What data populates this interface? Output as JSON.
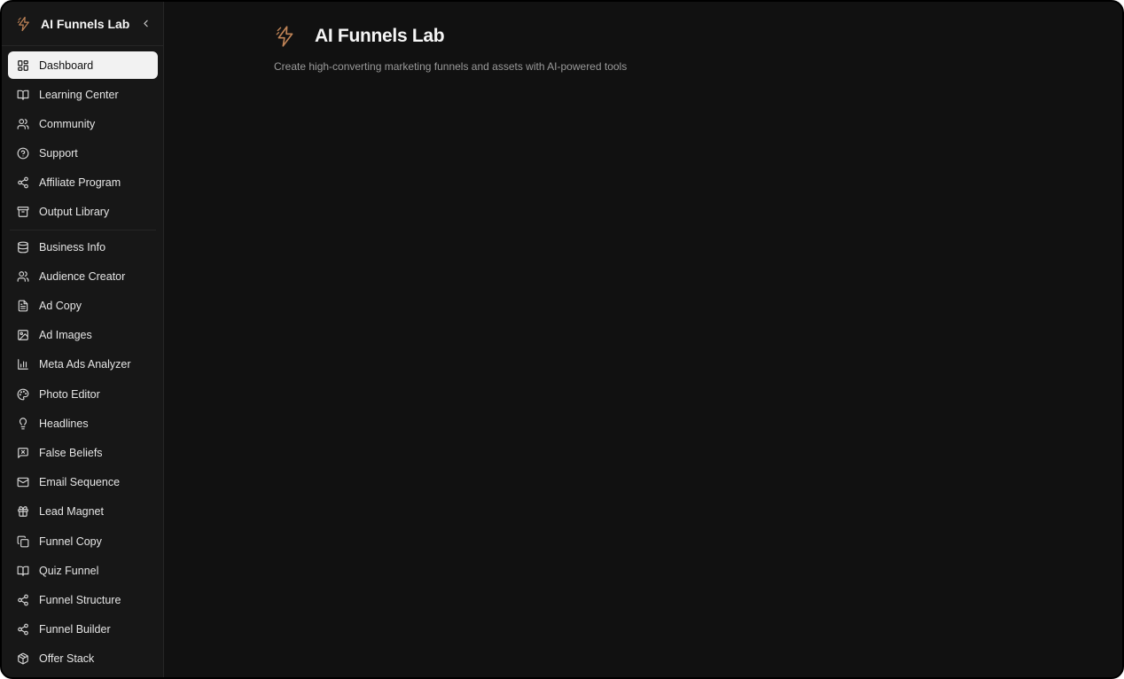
{
  "app": {
    "name": "AI Funnels Lab",
    "accent_color": "#c08457"
  },
  "sidebar": {
    "primary_items": [
      {
        "label": "Dashboard",
        "icon": "dashboard-grid-icon",
        "active": true
      },
      {
        "label": "Learning Center",
        "icon": "book-open-icon"
      },
      {
        "label": "Community",
        "icon": "users-icon"
      },
      {
        "label": "Support",
        "icon": "help-circle-icon"
      },
      {
        "label": "Affiliate Program",
        "icon": "share-icon"
      },
      {
        "label": "Output Library",
        "icon": "archive-icon"
      }
    ],
    "tool_items": [
      {
        "label": "Business Info",
        "icon": "database-icon"
      },
      {
        "label": "Audience Creator",
        "icon": "users-icon"
      },
      {
        "label": "Ad Copy",
        "icon": "file-text-icon"
      },
      {
        "label": "Ad Images",
        "icon": "image-icon"
      },
      {
        "label": "Meta Ads Analyzer",
        "icon": "bar-chart-icon"
      },
      {
        "label": "Photo Editor",
        "icon": "palette-icon"
      },
      {
        "label": "Headlines",
        "icon": "lightbulb-icon"
      },
      {
        "label": "False Beliefs",
        "icon": "message-x-icon"
      },
      {
        "label": "Email Sequence",
        "icon": "mail-icon"
      },
      {
        "label": "Lead Magnet",
        "icon": "gift-icon"
      },
      {
        "label": "Funnel Copy",
        "icon": "copy-icon"
      },
      {
        "label": "Quiz Funnel",
        "icon": "book-open-icon"
      },
      {
        "label": "Funnel Structure",
        "icon": "share-icon"
      },
      {
        "label": "Funnel Builder",
        "icon": "share-icon"
      },
      {
        "label": "Offer Stack",
        "icon": "package-icon"
      }
    ]
  },
  "main": {
    "title": "AI Funnels Lab",
    "subtitle": "Create high-converting marketing funnels and assets with AI-powered tools"
  }
}
